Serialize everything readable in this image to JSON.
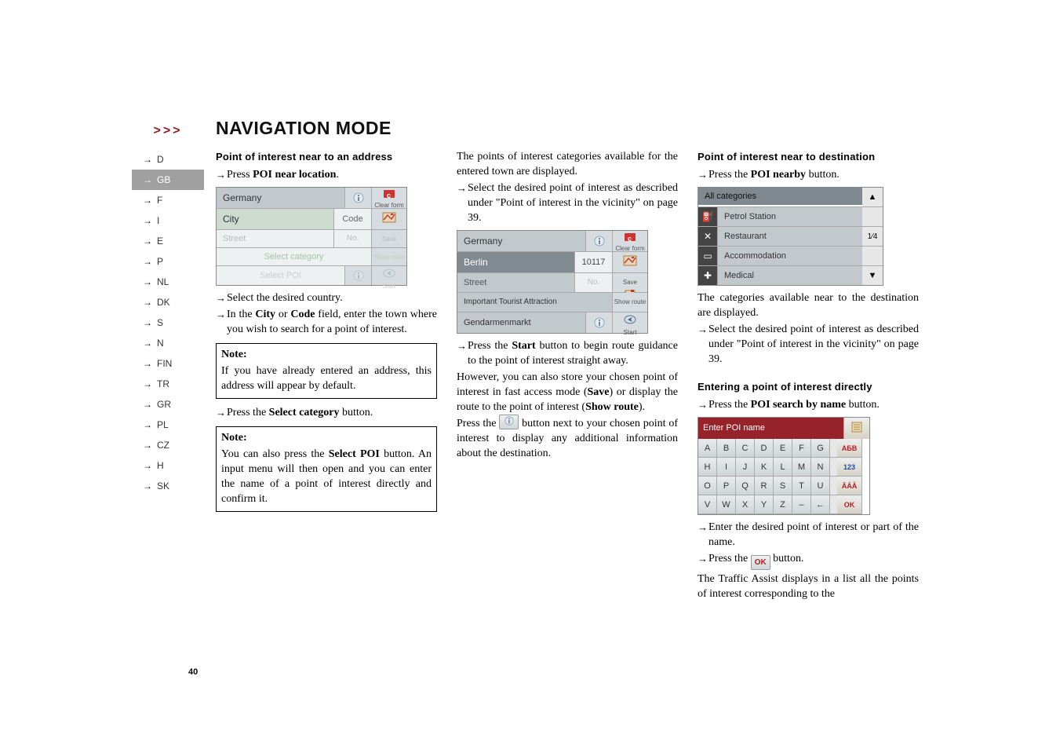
{
  "header": {
    "arrows": ">>>",
    "title": "NAVIGATION MODE"
  },
  "pageNumber": "40",
  "sidebar": {
    "items": [
      {
        "code": "D",
        "active": false
      },
      {
        "code": "GB",
        "active": true
      },
      {
        "code": "F",
        "active": false
      },
      {
        "code": "I",
        "active": false
      },
      {
        "code": "E",
        "active": false
      },
      {
        "code": "P",
        "active": false
      },
      {
        "code": "NL",
        "active": false
      },
      {
        "code": "DK",
        "active": false
      },
      {
        "code": "S",
        "active": false
      },
      {
        "code": "N",
        "active": false
      },
      {
        "code": "FIN",
        "active": false
      },
      {
        "code": "TR",
        "active": false
      },
      {
        "code": "GR",
        "active": false
      },
      {
        "code": "PL",
        "active": false
      },
      {
        "code": "CZ",
        "active": false
      },
      {
        "code": "H",
        "active": false
      },
      {
        "code": "SK",
        "active": false
      }
    ]
  },
  "col1": {
    "heading": "Point of interest near to an address",
    "step1_pre": "Press ",
    "step1_bold": "POI near location",
    "step1_post": ".",
    "shot1": {
      "country": "Germany",
      "cityLabel": "City",
      "codeLabel": "Code",
      "streetLabel": "Street",
      "noLabel": "No.",
      "selectCategory": "Select category",
      "selectPOI": "Select POI",
      "clearForm": "Clear form",
      "save": "Save",
      "showRoute": "Show route",
      "start": "Start"
    },
    "step2": "Select the desired country.",
    "step3_pre": "In the ",
    "step3_b1": "City",
    "step3_mid": " or ",
    "step3_b2": "Code",
    "step3_post": " field, enter the town where you wish to search for a point of interest.",
    "note1": {
      "label": "Note:",
      "text": "If you have already entered an address, this address will appear by default."
    },
    "step4_pre": "Press the ",
    "step4_bold": "Select category",
    "step4_post": " button.",
    "note2": {
      "label": "Note:",
      "text_pre": "You can also press the ",
      "text_bold": "Select POI",
      "text_post": " button. An input menu will then open and you can enter the name of a point of interest directly and confirm it."
    }
  },
  "col2": {
    "intro": "The points of interest categories available for the entered town are displayed.",
    "step1": "Select the desired point of interest as described under \"Point of interest in the vicinity\" on page 39.",
    "shot2": {
      "country": "Germany",
      "city": "Berlin",
      "code": "10117",
      "streetLabel": "Street",
      "noLabel": "No.",
      "category": "Important Tourist Attraction",
      "poi": "Gendarmenmarkt",
      "clearForm": "Clear form",
      "save": "Save",
      "showRoute": "Show route",
      "start": "Start"
    },
    "step2_pre": "Press the ",
    "step2_bold": "Start",
    "step2_post": " button to begin route guidance to the point of interest straight away.",
    "para1_a": "However, you can also store your chosen point of interest in fast access mode (",
    "para1_b": "Save",
    "para1_c": ") or display the route to the point of interest (",
    "para1_d": "Show route",
    "para1_e": ").",
    "para2_a": "Press the ",
    "para2_b": " button next to your chosen point of interest to display any additional information about the destination."
  },
  "col3": {
    "heading1": "Point of interest near to destination",
    "step1_pre": "Press the ",
    "step1_bold": "POI nearby",
    "step1_post": " button.",
    "catlist": {
      "all": "All categories",
      "items": [
        {
          "icon": "fuel",
          "label": "Petrol Station"
        },
        {
          "icon": "fork",
          "label": "Restaurant"
        },
        {
          "icon": "bed",
          "label": "Accommodation"
        },
        {
          "icon": "cross",
          "label": "Medical"
        }
      ],
      "pageIndicator": "1⁄4"
    },
    "afterCat1": "The categories available near to the destination are displayed.",
    "step2": "Select the desired point of interest as described under \"Point of interest in the vicinity\" on page 39.",
    "heading2": "Entering a point of interest directly",
    "step3_pre": "Press the ",
    "step3_bold": "POI search by name",
    "step3_post": " button.",
    "keyboard": {
      "title": "Enter POI name",
      "rows": [
        [
          "A",
          "B",
          "C",
          "D",
          "E",
          "F",
          "G"
        ],
        [
          "H",
          "I",
          "J",
          "K",
          "L",
          "M",
          "N"
        ],
        [
          "O",
          "P",
          "Q",
          "R",
          "S",
          "T",
          "U"
        ],
        [
          "V",
          "W",
          "X",
          "Y",
          "Z",
          "–",
          "←"
        ]
      ],
      "aux": [
        "АБВ",
        "123",
        "ÄÁÀ",
        "OK"
      ]
    },
    "step4": "Enter the desired point of interest or part of the name.",
    "step5_pre": "Press the ",
    "step5_post": " button.",
    "closing": "The Traffic Assist displays in a list all the points of interest corresponding to the"
  }
}
